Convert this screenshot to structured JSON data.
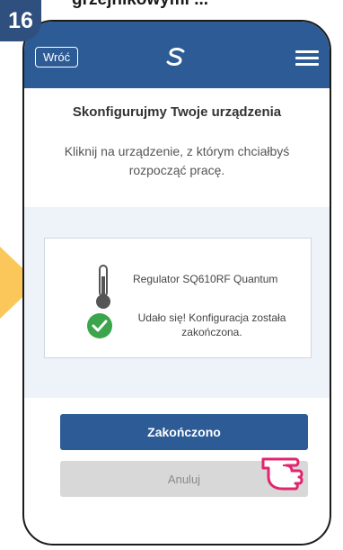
{
  "caption": {
    "text": "grzejnikowymi ... "
  },
  "step": {
    "number": "16"
  },
  "header": {
    "back_label": "Wróć"
  },
  "page": {
    "title": "Skonfigurujmy Twoje urządzenia",
    "instruction": "Kliknij na urządzenie, z którym chciałbyś rozpocząć pracę."
  },
  "device": {
    "name": "Regulator SQ610RF Quantum",
    "status": "Udało się! Konfiguracja została zakończona.",
    "icon": "thermometer-icon",
    "status_icon": "check-circle-icon"
  },
  "actions": {
    "done_label": "Zakończono",
    "cancel_label": "Anuluj"
  },
  "colors": {
    "brand": "#2c5b95",
    "success": "#3aa54b",
    "highlight": "#e1266f",
    "arrow": "#fbc75a"
  }
}
